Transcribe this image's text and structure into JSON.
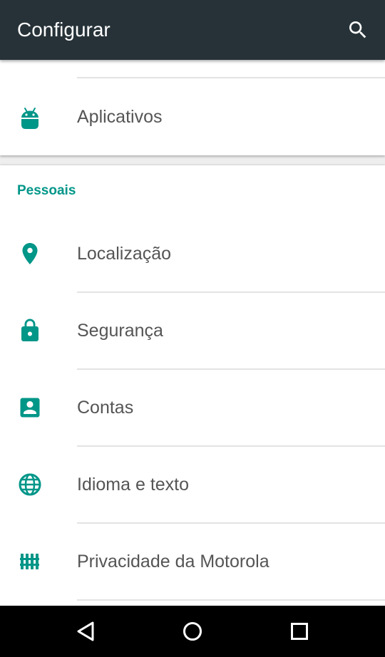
{
  "app_bar": {
    "title": "Configurar",
    "background": "#263238",
    "search_icon": "search-icon"
  },
  "top_card": {
    "items": [
      {
        "label": "Aplicativos",
        "icon": "android-icon",
        "icon_color": "#009688"
      }
    ]
  },
  "personal_section": {
    "header": "Pessoais",
    "header_color": "#009688",
    "items": [
      {
        "label": "Localização",
        "icon": "location-pin-icon"
      },
      {
        "label": "Segurança",
        "icon": "lock-icon"
      },
      {
        "label": "Contas",
        "icon": "account-box-icon"
      },
      {
        "label": "Idioma e texto",
        "icon": "globe-icon"
      },
      {
        "label": "Privacidade da Motorola",
        "icon": "privacy-fence-icon"
      }
    ]
  },
  "nav_bar": {
    "buttons": [
      "back-icon",
      "home-icon",
      "recents-icon"
    ]
  }
}
